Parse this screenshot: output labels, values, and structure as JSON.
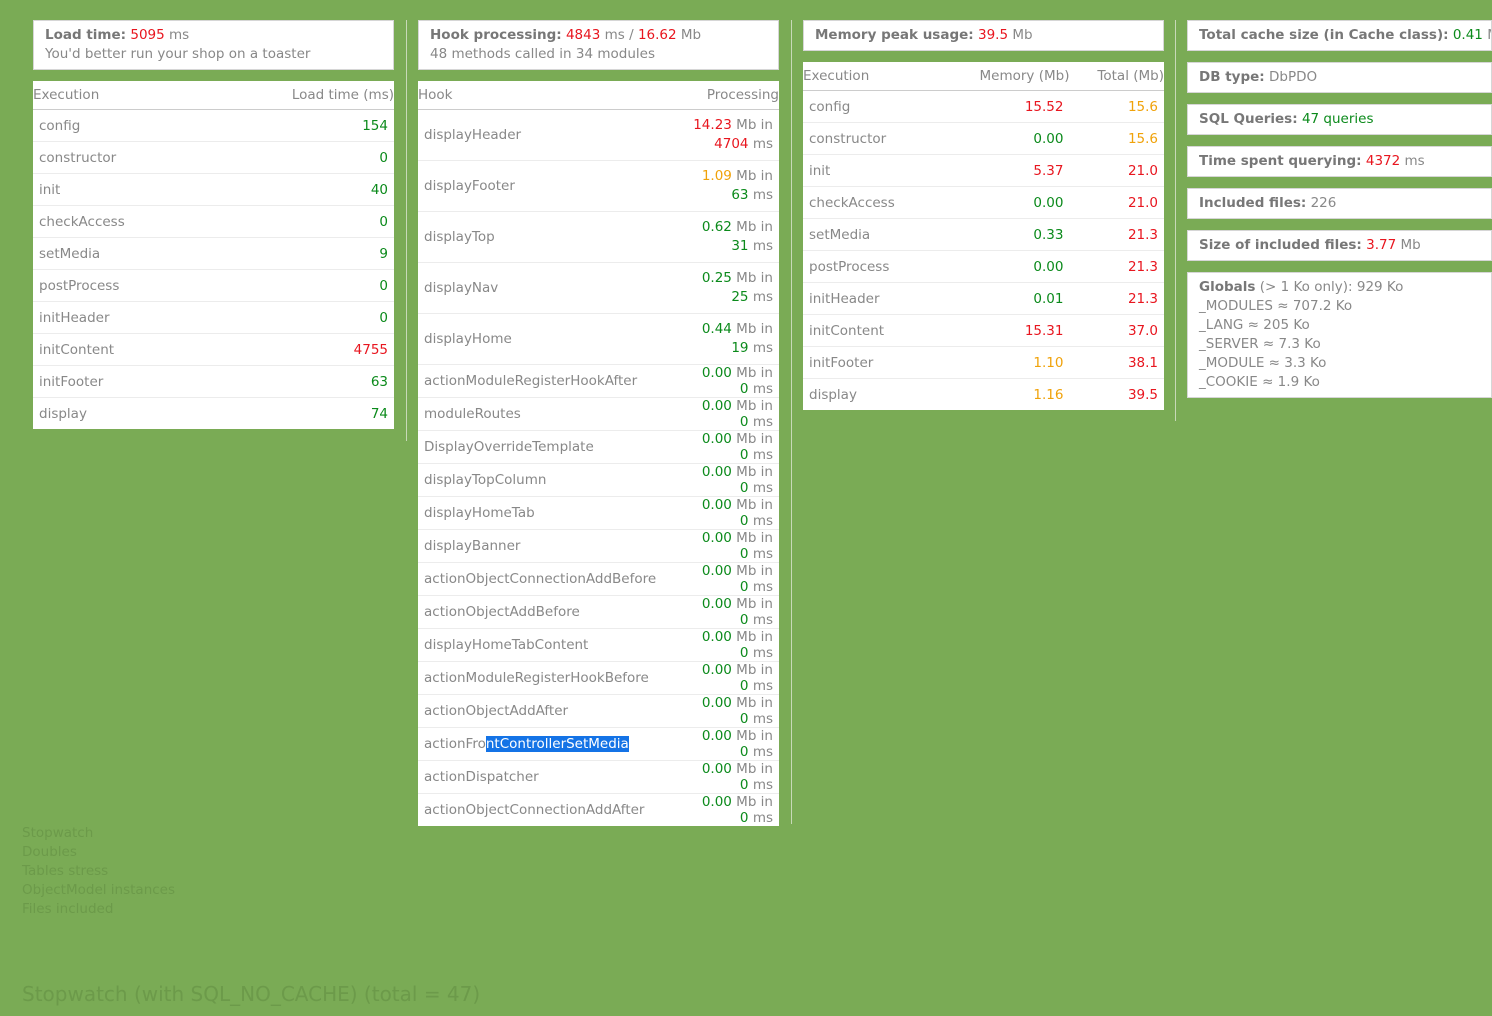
{
  "load": {
    "label": "Load time",
    "value": "5095",
    "unit": "ms",
    "comment": "You'd better run your shop on a toaster"
  },
  "exec_table": {
    "headers": [
      "Execution",
      "Load time (ms)"
    ],
    "rows": [
      {
        "name": "config",
        "value": "154",
        "color": "green"
      },
      {
        "name": "constructor",
        "value": "0",
        "color": "green"
      },
      {
        "name": "init",
        "value": "40",
        "color": "green"
      },
      {
        "name": "checkAccess",
        "value": "0",
        "color": "green"
      },
      {
        "name": "setMedia",
        "value": "9",
        "color": "green"
      },
      {
        "name": "postProcess",
        "value": "0",
        "color": "green"
      },
      {
        "name": "initHeader",
        "value": "0",
        "color": "green"
      },
      {
        "name": "initContent",
        "value": "4755",
        "color": "red"
      },
      {
        "name": "initFooter",
        "value": "63",
        "color": "green"
      },
      {
        "name": "display",
        "value": "74",
        "color": "green"
      }
    ]
  },
  "hook": {
    "label": "Hook processing",
    "time": "4843",
    "time_unit": "ms",
    "sep": " / ",
    "mem": "16.62",
    "mem_unit": "Mb",
    "summary": "48 methods called in 34 modules"
  },
  "hook_table": {
    "headers": [
      "Hook",
      "Processing"
    ],
    "mb_in": "Mb in",
    "ms": "ms",
    "rows": [
      {
        "name": "displayHeader",
        "mb": "14.23",
        "mb_color": "red",
        "ms": "4704",
        "ms_color": "red",
        "tall": true
      },
      {
        "name": "displayFooter",
        "mb": "1.09",
        "mb_color": "orange",
        "ms": "63",
        "ms_color": "green",
        "tall": true
      },
      {
        "name": "displayTop",
        "mb": "0.62",
        "mb_color": "green",
        "ms": "31",
        "ms_color": "green",
        "tall": true
      },
      {
        "name": "displayNav",
        "mb": "0.25",
        "mb_color": "green",
        "ms": "25",
        "ms_color": "green",
        "tall": true
      },
      {
        "name": "displayHome",
        "mb": "0.44",
        "mb_color": "green",
        "ms": "19",
        "ms_color": "green",
        "tall": true
      },
      {
        "name": "actionModuleRegisterHookAfter",
        "mb": "0.00",
        "mb_color": "green",
        "ms": "0",
        "ms_color": "green"
      },
      {
        "name": "moduleRoutes",
        "mb": "0.00",
        "mb_color": "green",
        "ms": "0",
        "ms_color": "green"
      },
      {
        "name": "DisplayOverrideTemplate",
        "mb": "0.00",
        "mb_color": "green",
        "ms": "0",
        "ms_color": "green"
      },
      {
        "name": "displayTopColumn",
        "mb": "0.00",
        "mb_color": "green",
        "ms": "0",
        "ms_color": "green"
      },
      {
        "name": "displayHomeTab",
        "mb": "0.00",
        "mb_color": "green",
        "ms": "0",
        "ms_color": "green"
      },
      {
        "name": "displayBanner",
        "mb": "0.00",
        "mb_color": "green",
        "ms": "0",
        "ms_color": "green"
      },
      {
        "name": "actionObjectConnectionAddBefore",
        "mb": "0.00",
        "mb_color": "green",
        "ms": "0",
        "ms_color": "green"
      },
      {
        "name": "actionObjectAddBefore",
        "mb": "0.00",
        "mb_color": "green",
        "ms": "0",
        "ms_color": "green"
      },
      {
        "name": "displayHomeTabContent",
        "mb": "0.00",
        "mb_color": "green",
        "ms": "0",
        "ms_color": "green"
      },
      {
        "name": "actionModuleRegisterHookBefore",
        "mb": "0.00",
        "mb_color": "green",
        "ms": "0",
        "ms_color": "green"
      },
      {
        "name": "actionObjectAddAfter",
        "mb": "0.00",
        "mb_color": "green",
        "ms": "0",
        "ms_color": "green"
      },
      {
        "name": "actionFrontControllerSetMedia",
        "name_pre": "actionFro",
        "name_sel": "ntControllerSetMedia",
        "mb": "0.00",
        "mb_color": "green",
        "ms": "0",
        "ms_color": "green"
      },
      {
        "name": "actionDispatcher",
        "mb": "0.00",
        "mb_color": "green",
        "ms": "0",
        "ms_color": "green"
      },
      {
        "name": "actionObjectConnectionAddAfter",
        "mb": "0.00",
        "mb_color": "green",
        "ms": "0",
        "ms_color": "green"
      }
    ]
  },
  "memory": {
    "label": "Memory peak usage",
    "value": "39.5",
    "unit": "Mb"
  },
  "mem_table": {
    "headers": [
      "Execution",
      "Memory (Mb)",
      "Total (Mb)"
    ],
    "rows": [
      {
        "name": "config",
        "mem": "15.52",
        "mem_color": "red",
        "total": "15.6",
        "total_color": "orange"
      },
      {
        "name": "constructor",
        "mem": "0.00",
        "mem_color": "green",
        "total": "15.6",
        "total_color": "orange"
      },
      {
        "name": "init",
        "mem": "5.37",
        "mem_color": "red",
        "total": "21.0",
        "total_color": "red"
      },
      {
        "name": "checkAccess",
        "mem": "0.00",
        "mem_color": "green",
        "total": "21.0",
        "total_color": "red"
      },
      {
        "name": "setMedia",
        "mem": "0.33",
        "mem_color": "green",
        "total": "21.3",
        "total_color": "red"
      },
      {
        "name": "postProcess",
        "mem": "0.00",
        "mem_color": "green",
        "total": "21.3",
        "total_color": "red"
      },
      {
        "name": "initHeader",
        "mem": "0.01",
        "mem_color": "green",
        "total": "21.3",
        "total_color": "red"
      },
      {
        "name": "initContent",
        "mem": "15.31",
        "mem_color": "red",
        "total": "37.0",
        "total_color": "red"
      },
      {
        "name": "initFooter",
        "mem": "1.10",
        "mem_color": "orange",
        "total": "38.1",
        "total_color": "red"
      },
      {
        "name": "display",
        "mem": "1.16",
        "mem_color": "orange",
        "total": "39.5",
        "total_color": "red"
      }
    ]
  },
  "stats": {
    "cache_label": "Total cache size (in Cache class)",
    "cache_value": "0.41",
    "cache_unit": "Mb",
    "db_label": "DB type",
    "db_value": "DbPDO",
    "sql_label": "SQL Queries",
    "sql_value": "47 queries",
    "time_label": "Time spent querying",
    "time_value": "4372",
    "time_unit": "ms",
    "files_label": "Included files",
    "files_value": "226",
    "size_label": "Size of included files",
    "size_value": "3.77",
    "size_unit": "Mb",
    "globals_label": "Globals",
    "globals_suffix": "(> 1 Ko only): 929 Ko",
    "globals": [
      "_MODULES ≈ 707.2 Ko",
      "_LANG ≈ 205 Ko",
      "_SERVER ≈ 7.3 Ko",
      "_MODULE ≈ 3.3 Ko",
      "_COOKIE ≈ 1.9 Ko"
    ]
  },
  "links": [
    "Stopwatch",
    "Doubles",
    "Tables stress",
    "ObjectModel instances",
    "Files included"
  ],
  "bottom_title": "Stopwatch (with SQL_NO_CACHE) (total = 47)"
}
